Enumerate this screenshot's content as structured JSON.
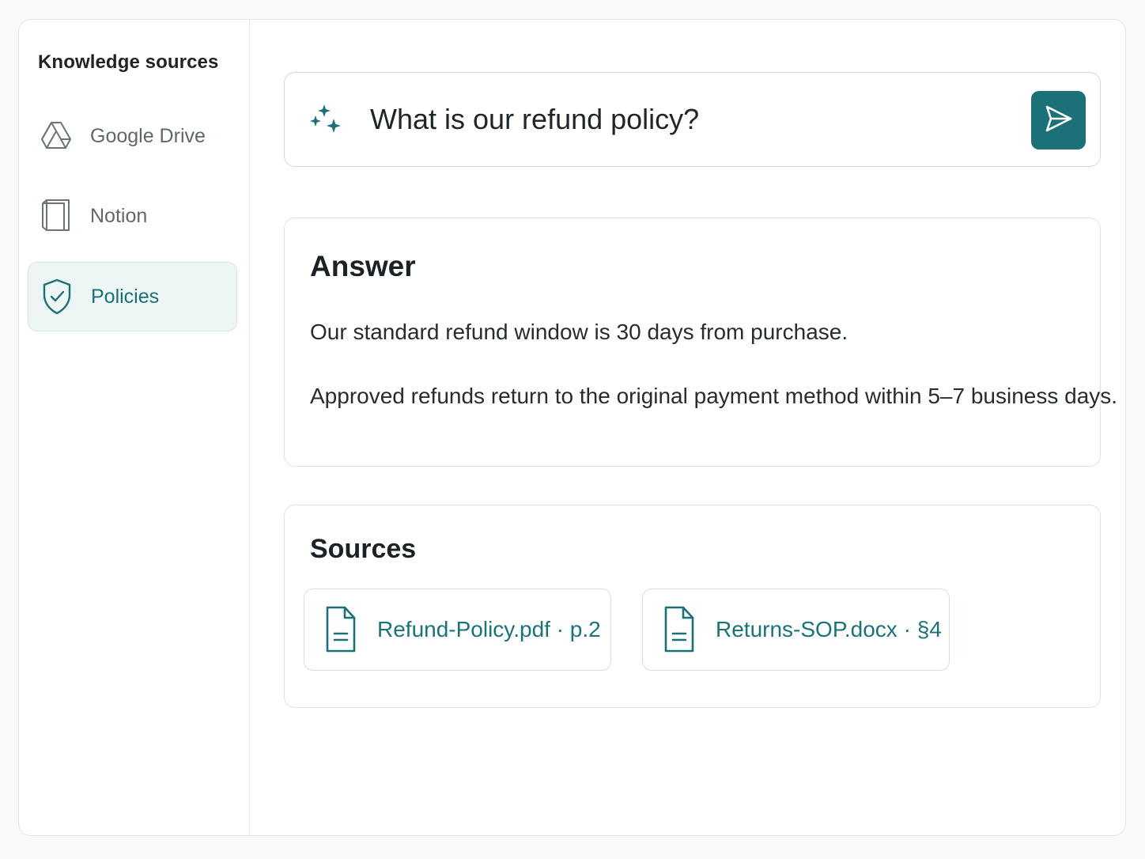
{
  "sidebar": {
    "title": "Knowledge sources",
    "items": [
      {
        "label": "Google Drive",
        "icon": "google-drive-icon",
        "active": false
      },
      {
        "label": "Notion",
        "icon": "notion-icon",
        "active": false
      },
      {
        "label": "Policies",
        "icon": "shield-check-icon",
        "active": true
      }
    ]
  },
  "query": {
    "value": "What is our refund policy?",
    "icon": "sparkle-icon",
    "send_icon": "send-icon"
  },
  "answer": {
    "heading": "Answer",
    "paragraphs": [
      "Our standard refund window is 30 days from purchase.",
      "Approved refunds return to the original payment method within 5–7 business days."
    ]
  },
  "sources": {
    "heading": "Sources",
    "items": [
      {
        "label": "Refund-Policy.pdf · p.2",
        "icon": "document-icon"
      },
      {
        "label": "Returns-SOP.docx · §4",
        "icon": "document-icon"
      }
    ]
  },
  "colors": {
    "accent": "#1c7077",
    "accent_bg": "#eef5f5",
    "muted_text": "#5f686d"
  }
}
